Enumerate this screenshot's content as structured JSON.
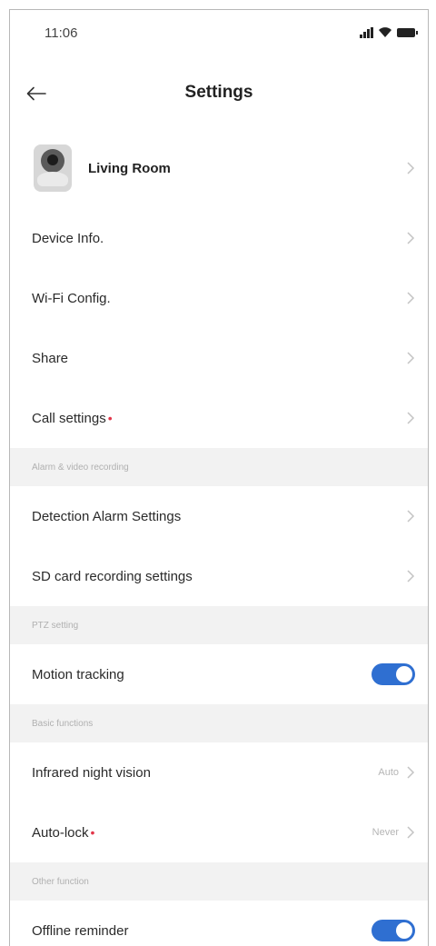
{
  "status_bar": {
    "time": "11:06"
  },
  "nav": {
    "title": "Settings"
  },
  "device": {
    "name": "Living Room"
  },
  "rows_a": [
    {
      "label": "Device Info."
    },
    {
      "label": "Wi-Fi Config."
    },
    {
      "label": "Share"
    },
    {
      "label": "Call settings",
      "dot": "•"
    }
  ],
  "sections": {
    "alarm": "Alarm & video recording",
    "ptz": "PTZ setting",
    "basic": "Basic functions",
    "other": "Other function"
  },
  "rows_b": [
    {
      "label": "Detection Alarm Settings"
    },
    {
      "label": "SD card recording settings"
    }
  ],
  "motion_tracking": {
    "label": "Motion tracking",
    "enabled": true
  },
  "infrared": {
    "label": "Infrared night vision",
    "value": "Auto"
  },
  "auto_lock": {
    "label": "Auto-lock",
    "dot": "•",
    "value": "Never"
  },
  "offline_reminder": {
    "label": "Offline reminder",
    "enabled": true
  },
  "colors": {
    "accent": "#2f6fd1",
    "badge": "#e2364a",
    "section_bg": "#f2f2f2"
  }
}
